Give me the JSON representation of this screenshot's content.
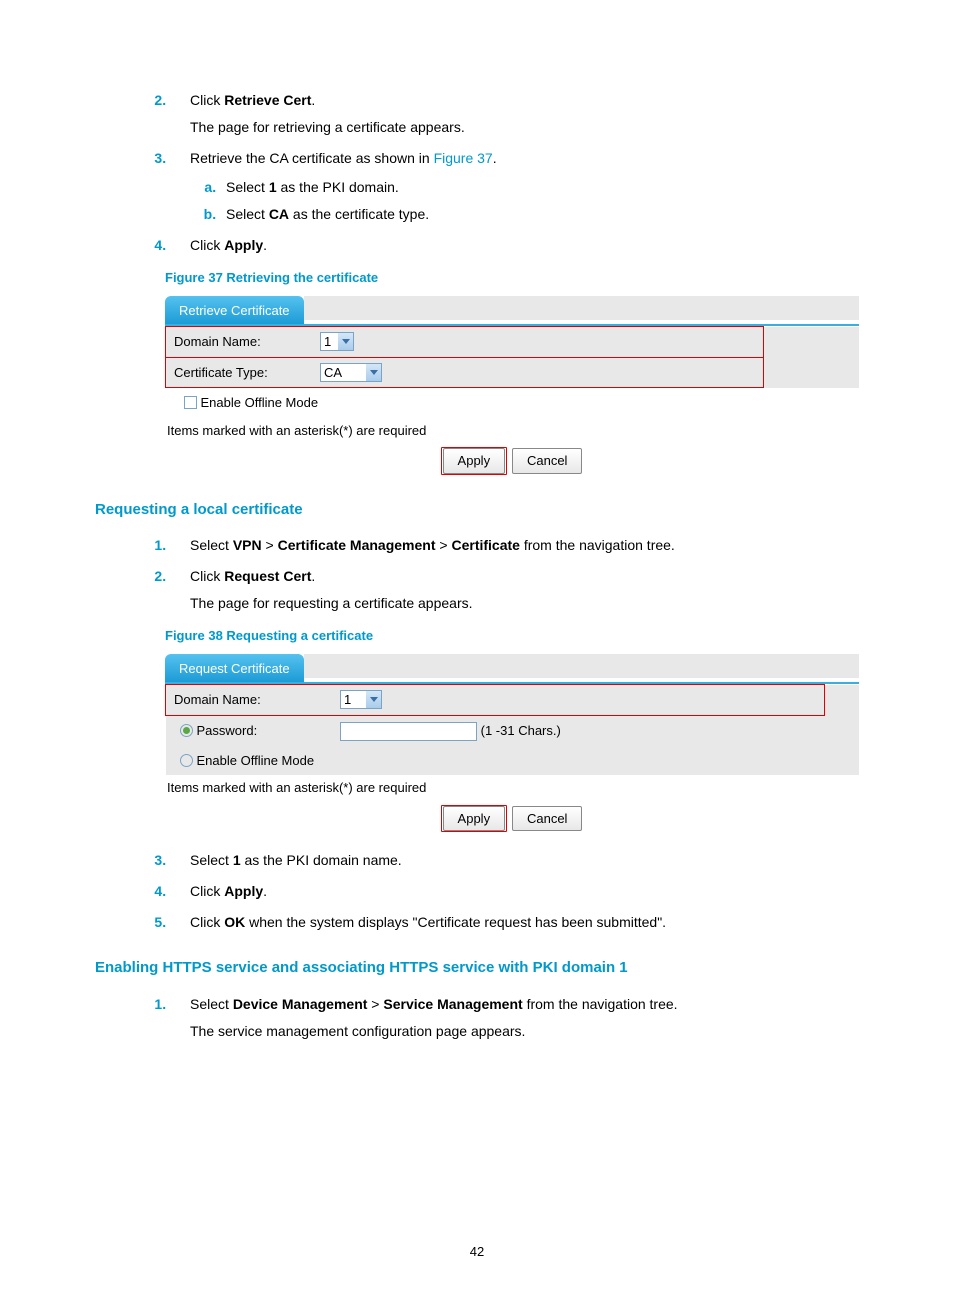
{
  "page_number": "42",
  "section1": {
    "steps": {
      "s2": {
        "num": "2.",
        "prefix": "Click ",
        "bold": "Retrieve Cert",
        "suffix": ".",
        "sub": "The page for retrieving a certificate appears."
      },
      "s3": {
        "num": "3.",
        "text_a": "Retrieve the CA certificate as shown in ",
        "link": "Figure 37",
        "text_b": ".",
        "a": {
          "pre": "Select ",
          "bold": "1",
          "post": " as the PKI domain."
        },
        "b": {
          "pre": "Select ",
          "bold": "CA",
          "post": " as the certificate type."
        }
      },
      "s4": {
        "num": "4.",
        "pre": "Click ",
        "bold": "Apply",
        "post": "."
      }
    }
  },
  "figure37": {
    "caption": "Figure 37 Retrieving the certificate",
    "tab": "Retrieve Certificate",
    "domain_label": "Domain Name:",
    "domain_value": "1",
    "cert_type_label": "Certificate Type:",
    "cert_type_value": "CA",
    "offline_label": "Enable Offline Mode",
    "required": "Items marked with an asterisk(*) are required",
    "apply": "Apply",
    "cancel": "Cancel"
  },
  "heading_request": "Requesting a local certificate",
  "request_steps": {
    "s1": {
      "num": "1.",
      "pre": "Select ",
      "b1": "VPN",
      "gt1": " > ",
      "b2": "Certificate Management",
      "gt2": " > ",
      "b3": "Certificate",
      "post": " from the navigation tree."
    },
    "s2": {
      "num": "2.",
      "pre": "Click ",
      "bold": "Request Cert",
      "post": ".",
      "sub": "The page for requesting a certificate appears."
    }
  },
  "figure38": {
    "caption": "Figure 38 Requesting a certificate",
    "tab": "Request Certificate",
    "domain_label": "Domain Name:",
    "domain_value": "1",
    "password_label": "Password:",
    "password_hint": "(1 -31 Chars.)",
    "offline_label": "Enable Offline Mode",
    "required": "Items marked with an asterisk(*) are required",
    "apply": "Apply",
    "cancel": "Cancel"
  },
  "after_fig38": {
    "s3": {
      "num": "3.",
      "pre": "Select ",
      "bold": "1",
      "post": " as the PKI domain name."
    },
    "s4": {
      "num": "4.",
      "pre": "Click ",
      "bold": "Apply",
      "post": "."
    },
    "s5": {
      "num": "5.",
      "pre": "Click ",
      "bold": "OK",
      "post": " when the system displays \"Certificate request has been submitted\"."
    }
  },
  "heading_https": "Enabling HTTPS service and associating HTTPS service with PKI domain 1",
  "https_steps": {
    "s1": {
      "num": "1.",
      "pre": "Select ",
      "b1": "Device Management",
      "gt": " > ",
      "b2": "Service Management",
      "post": " from the navigation tree.",
      "sub": "The service management configuration page appears."
    }
  }
}
